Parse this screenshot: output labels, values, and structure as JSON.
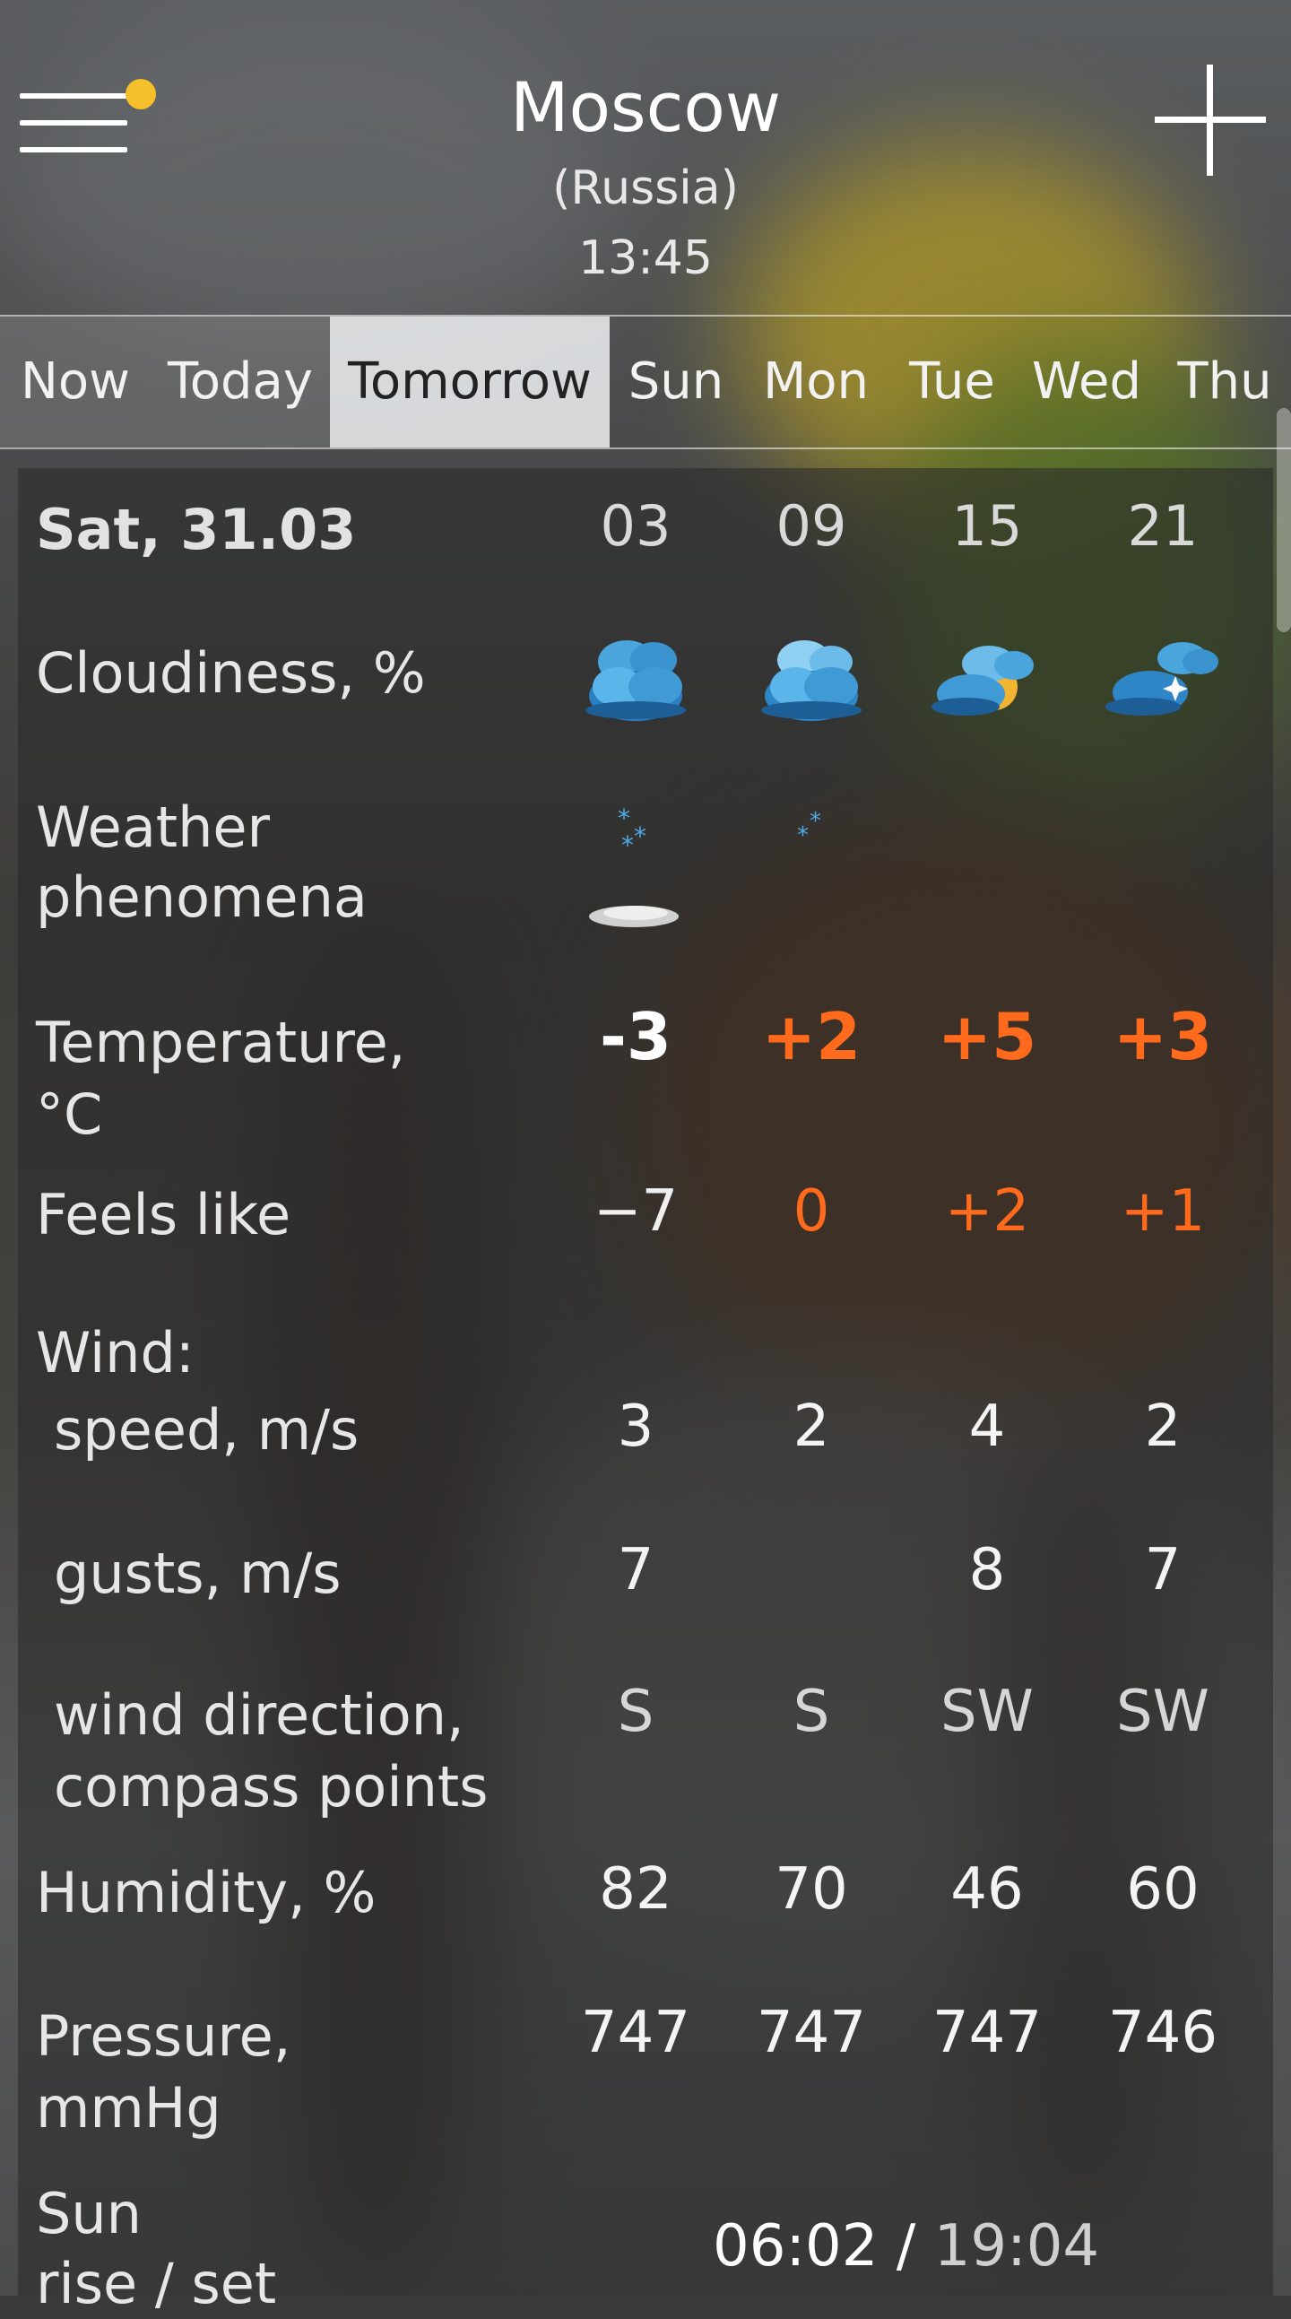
{
  "header": {
    "city": "Moscow",
    "country": "(Russia)",
    "time": "13:45",
    "menu_icon": "hamburger-menu-icon",
    "add_icon": "plus-icon"
  },
  "tabs": [
    {
      "label": "Now",
      "active": false
    },
    {
      "label": "Today",
      "active": false
    },
    {
      "label": "Tomorrow",
      "active": true
    },
    {
      "label": "Sun",
      "active": false
    },
    {
      "label": "Mon",
      "active": false
    },
    {
      "label": "Tue",
      "active": false
    },
    {
      "label": "Wed",
      "active": false
    },
    {
      "label": "Thu",
      "active": false
    }
  ],
  "forecast": {
    "date": "Sat, 31.03",
    "hours": [
      "03",
      "09",
      "15",
      "21"
    ],
    "labels": {
      "cloudiness": "Cloudiness, %",
      "phenomena_1": "Weather",
      "phenomena_2": "phenomena",
      "temperature_1": "Temperature,",
      "temperature_2": "°C",
      "feels_like": "Feels like",
      "wind": "Wind:",
      "speed": "speed, m/s",
      "gusts": "gusts, m/s",
      "direction_1": "wind direction,",
      "direction_2": "compass points",
      "humidity": "Humidity, %",
      "pressure_1": "Pressure,",
      "pressure_2": "mmHg",
      "sun_1": "Sun",
      "sun_2": "rise / set"
    },
    "cloudiness_icons": [
      "overcast-cloud-icon",
      "cloudy-icon",
      "partly-cloudy-day-icon",
      "partly-cloudy-night-icon"
    ],
    "phenomena_icons": [
      "snow-fog-icon",
      "light-snow-icon",
      "",
      ""
    ],
    "temperature": [
      "-3",
      "+2",
      "+5",
      "+3"
    ],
    "feels_like": [
      "−7",
      "0",
      "+2",
      "+1"
    ],
    "wind_speed": [
      "3",
      "2",
      "4",
      "2"
    ],
    "wind_gusts": [
      "7",
      "",
      "8",
      "7"
    ],
    "wind_direction": [
      "S",
      "S",
      "SW",
      "SW"
    ],
    "humidity": [
      "82",
      "70",
      "46",
      "60"
    ],
    "pressure": [
      "747",
      "747",
      "747",
      "746"
    ],
    "sunrise": "06:02",
    "sun_separator": " / ",
    "sunset": "19:04"
  },
  "colors": {
    "accent_warm": "#ff6a1c",
    "menu_dot": "#f6c02a",
    "active_tab_bg": "#e6e8ea"
  }
}
